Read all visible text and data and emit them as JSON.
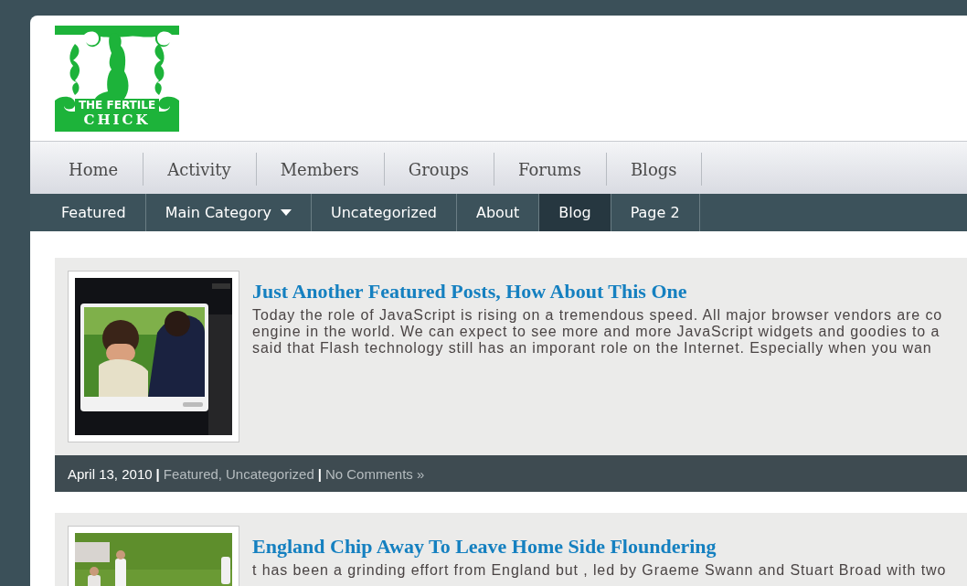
{
  "logo": {
    "line_1": "THE FERTILE",
    "line_2": "CHICK"
  },
  "main_nav": [
    {
      "label": "Home"
    },
    {
      "label": "Activity"
    },
    {
      "label": "Members"
    },
    {
      "label": "Groups"
    },
    {
      "label": "Forums"
    },
    {
      "label": "Blogs"
    }
  ],
  "sub_nav": [
    {
      "label": "Featured",
      "selected": false,
      "has_dropdown": false
    },
    {
      "label": "Main Category",
      "selected": false,
      "has_dropdown": true
    },
    {
      "label": "Uncategorized",
      "selected": false,
      "has_dropdown": false
    },
    {
      "label": "About",
      "selected": false,
      "has_dropdown": false
    },
    {
      "label": "Blog",
      "selected": true,
      "has_dropdown": false
    },
    {
      "label": "Page 2",
      "selected": false,
      "has_dropdown": false
    }
  ],
  "posts": [
    {
      "title": "Just Another Featured Posts, How About This One",
      "thumbnail": {
        "kind": "picture"
      },
      "excerpt_lines": [
        "Today the role of JavaScript is rising on a tremendous speed. All major browser vendors are co",
        "engine in the world. We can expect to see more and more JavaScript widgets and goodies to a",
        "said that Flash technology still has an imporant role on the Internet. Especially when you wan"
      ],
      "meta": [
        {
          "kind": "date",
          "text": "April 13, 2010"
        },
        {
          "kind": "separator",
          "text": "|"
        },
        {
          "kind": "link",
          "text": "Featured"
        },
        {
          "kind": "plain",
          "text": ","
        },
        {
          "kind": "link",
          "text": "Uncategorized"
        },
        {
          "kind": "separator",
          "text": "|"
        },
        {
          "kind": "link",
          "text": "No Comments »"
        }
      ]
    },
    {
      "title": "England Chip Away To Leave Home Side Floundering",
      "thumbnail": {
        "kind": "picture"
      },
      "excerpt_lines": [
        "t has been a grinding effort from England but , led by Graeme Swann and Stuart Broad with two"
      ]
    }
  ]
}
